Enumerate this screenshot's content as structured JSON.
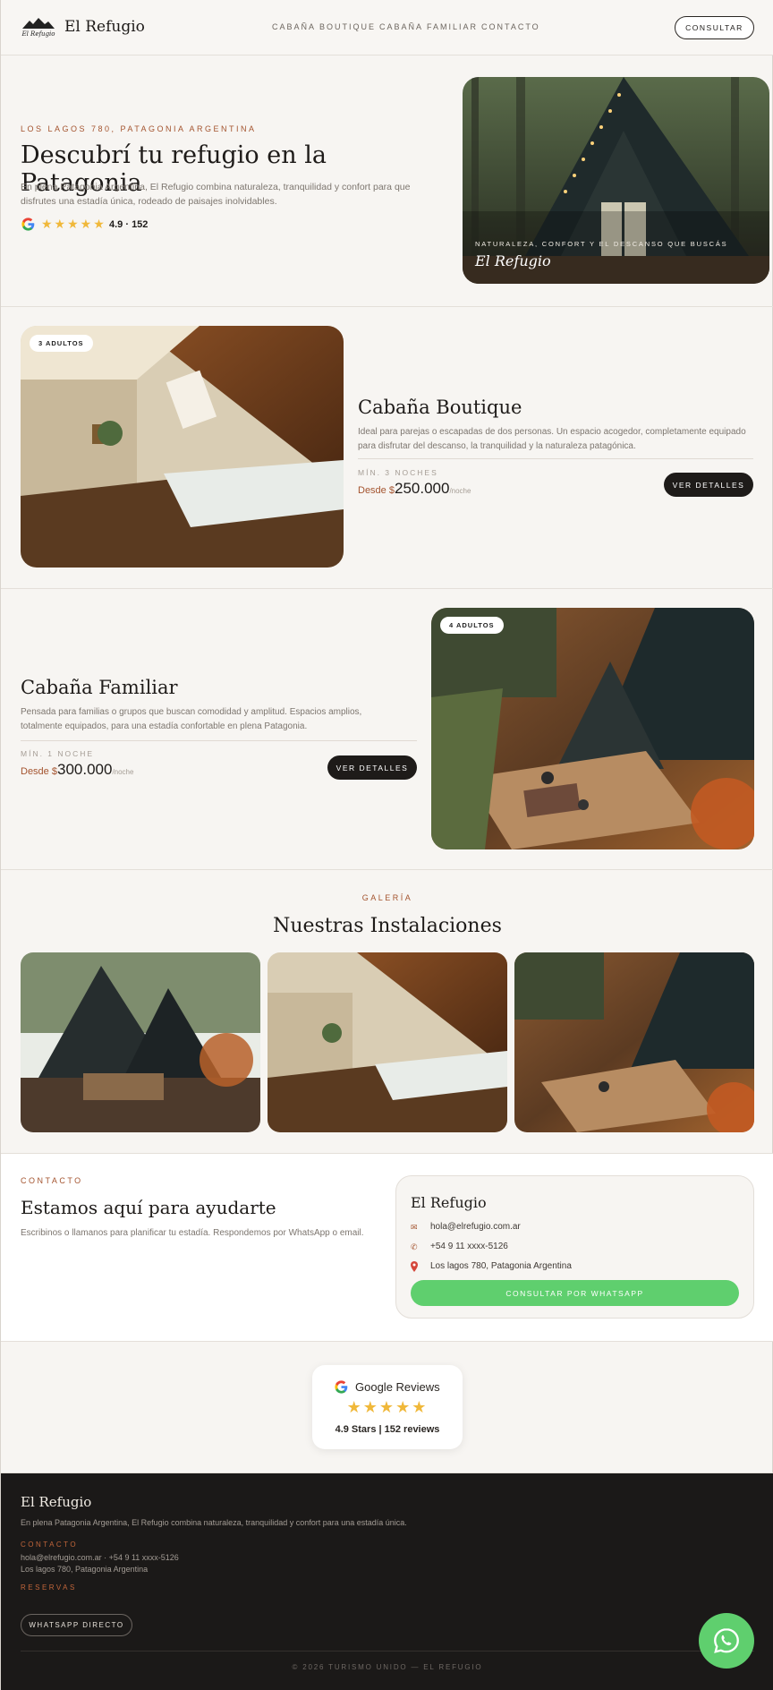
{
  "header": {
    "brand": "El Refugio",
    "logo_text": "El Refugio",
    "nav": [
      "CABAÑA BOUTIQUE",
      "CABAÑA FAMILIAR",
      "CONTACTO"
    ],
    "cta": "CONSULTAR"
  },
  "hero": {
    "eyebrow": "LOS LAGOS 780, PATAGONIA ARGENTINA",
    "title": "Descubrí tu refugio en la Patagonia",
    "description": "En plena Patagonia Argentina, El Refugio combina naturaleza, tranquilidad y confort para que disfrutes una estadía única, rodeado de paisajes inolvidables.",
    "rating_text": "4.9 · 152",
    "stars": "★★★★★",
    "image_caption": "NATURALEZA, CONFORT Y EL DESCANSO QUE BUSCÁS",
    "image_title": "El Refugio"
  },
  "boutique": {
    "badge": "3 ADULTOS",
    "title": "Cabaña Boutique",
    "description": "Ideal para parejas o escapadas de dos personas. Un espacio acogedor, completamente equipado para disfrutar del descanso, la tranquilidad y la naturaleza patagónica.",
    "min_nights": "MÍN. 3 NOCHES",
    "price_prefix": "Desde $",
    "price": "250.000",
    "price_unit": "/noche",
    "button": "VER DETALLES"
  },
  "familiar": {
    "badge": "4 ADULTOS",
    "title": "Cabaña Familiar",
    "description": "Pensada para familias o grupos que buscan comodidad y amplitud. Espacios amplios, totalmente equipados, para una estadía confortable en plena Patagonia.",
    "min_nights": "MÍN. 1 NOCHE",
    "price_prefix": "Desde $",
    "price": "300.000",
    "price_unit": "/noche",
    "button": "VER DETALLES"
  },
  "gallery": {
    "eyebrow": "GALERÍA",
    "title": "Nuestras Instalaciones"
  },
  "contact": {
    "eyebrow": "CONTACTO",
    "title": "Estamos aquí para ayudarte",
    "description": "Escribinos o llamanos para planificar tu estadía. Respondemos por WhatsApp o email.",
    "card_title": "El Refugio",
    "email": "hola@elrefugio.com.ar",
    "phone": "+54 9 11 xxxx-5126",
    "address": "Los lagos 780, Patagonia Argentina",
    "button": "CONSULTAR POR WHATSAPP"
  },
  "reviews": {
    "title": "Google Reviews",
    "stars": "★★★★★",
    "summary": "4.9 Stars | 152 reviews"
  },
  "footer": {
    "brand": "El Refugio",
    "description": "En plena Patagonia Argentina, El Refugio combina naturaleza, tranquilidad y confort para una estadía única.",
    "contact_label": "CONTACTO",
    "contact_line1": "hola@elrefugio.com.ar · +54 9 11 xxxx-5126",
    "contact_line2": "Los lagos 780, Patagonia Argentina",
    "reservas_label": "RESERVAS",
    "whatsapp_button": "WHATSAPP DIRECTO",
    "copyright": "© 2026 TURISMO UNIDO — EL REFUGIO"
  },
  "icons": {
    "google": "google-g-icon",
    "mail": "mail-icon",
    "phone": "phone-icon",
    "pin": "map-pin-icon",
    "whatsapp": "whatsapp-icon"
  },
  "colors": {
    "accent": "#a4542f",
    "dark": "#1b1918",
    "whatsapp": "#5fcf6e",
    "star": "#f0b83a"
  }
}
